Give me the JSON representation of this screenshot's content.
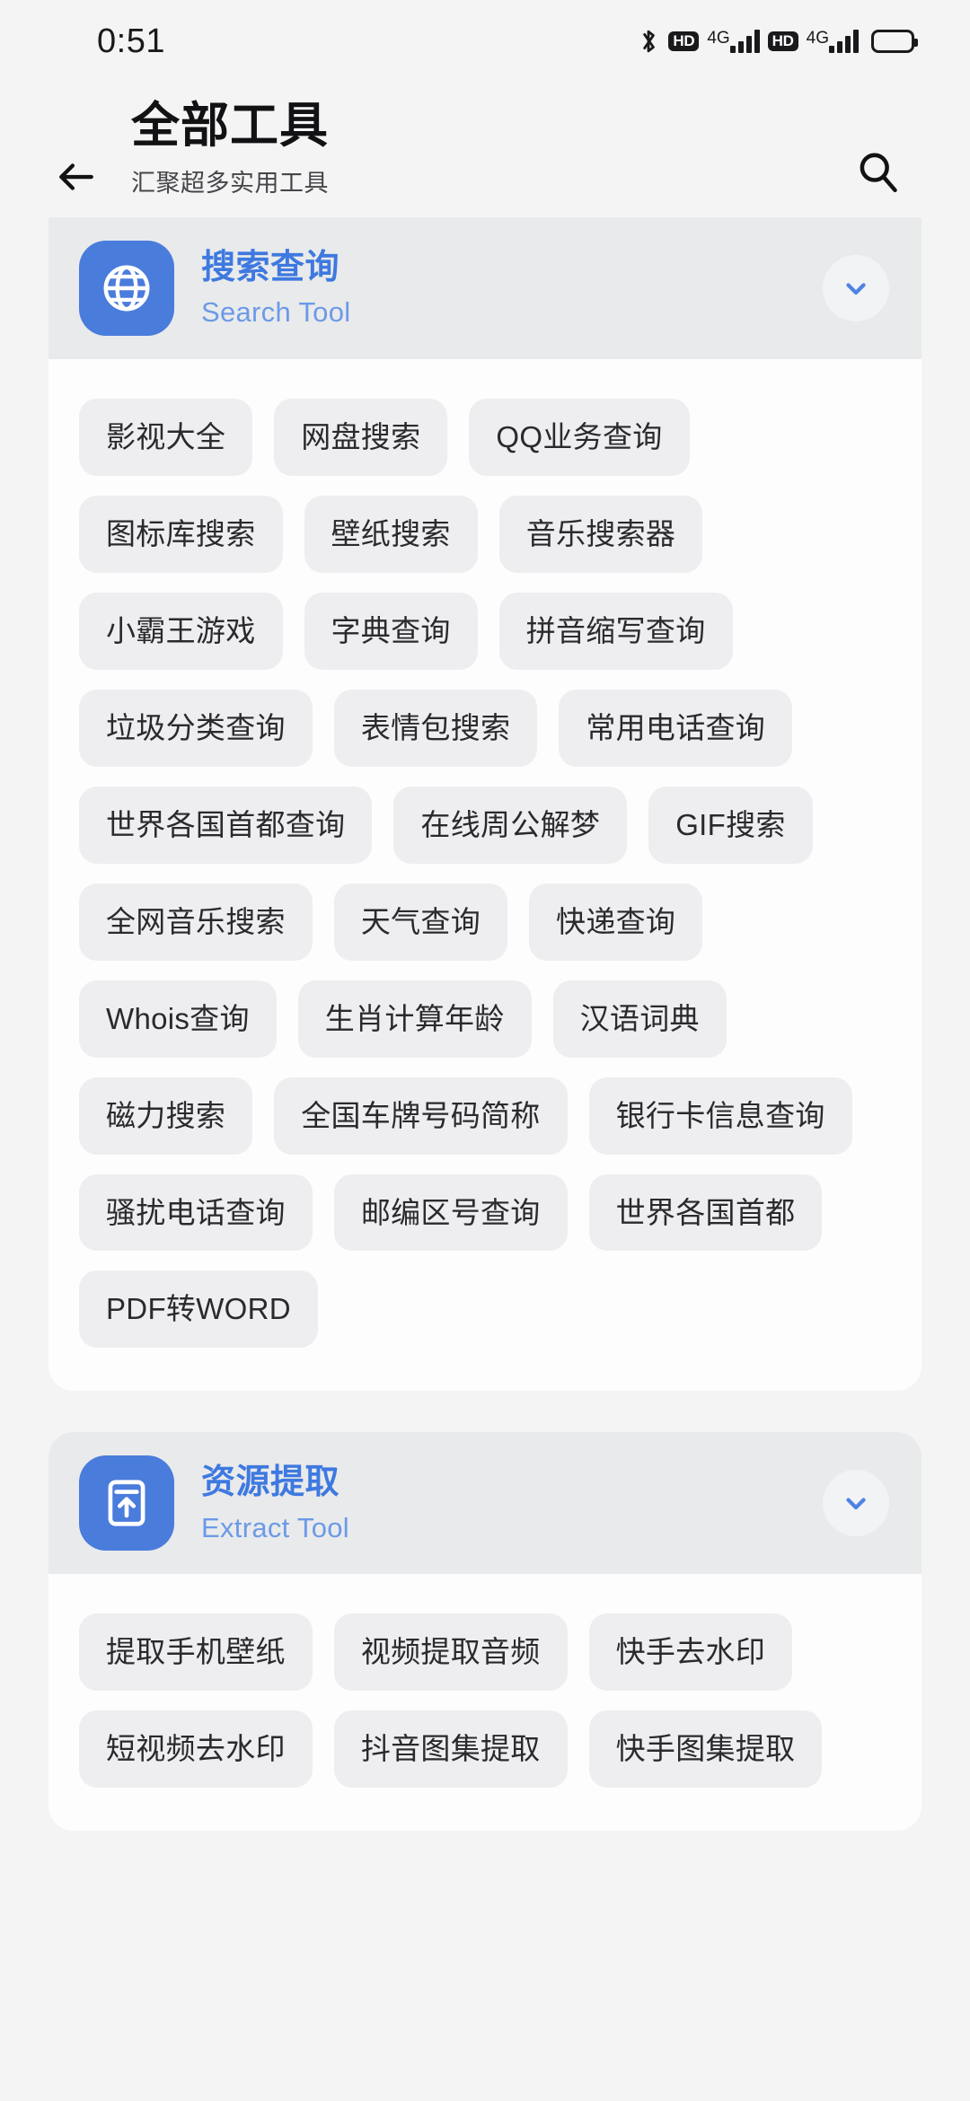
{
  "statusbar": {
    "time": "0:51",
    "icons": [
      "bluetooth-icon",
      "hd-badge",
      "4g-label",
      "signal-bars",
      "hd-badge",
      "4g-label",
      "signal-bars",
      "battery-icon"
    ],
    "hd_label": "HD",
    "network_label": "4G"
  },
  "appbar": {
    "back_icon": "arrow-left-icon",
    "title": "全部工具",
    "subtitle": "汇聚超多实用工具",
    "search_icon": "search-icon"
  },
  "colors": {
    "accent": "#3e79e0",
    "accent_sub": "#6c9ae8",
    "icon_bg": "#4a7cdc",
    "page_bg": "#f4f4f5",
    "card_bg": "#fdfdfd",
    "section_head_bg": "#e9eaeb",
    "chip_bg": "#eeeef0",
    "chip_text": "#2a2a2e"
  },
  "sections": [
    {
      "icon": "globe-icon",
      "title": "搜索查询",
      "subtitle": "Search Tool",
      "chevron": "chevron-down-icon",
      "expanded": true,
      "clipped_top": true,
      "chips": [
        "影视大全",
        "网盘搜索",
        "QQ业务查询",
        "图标库搜索",
        "壁纸搜索",
        "音乐搜索器",
        "小霸王游戏",
        "字典查询",
        "拼音缩写查询",
        "垃圾分类查询",
        "表情包搜索",
        "常用电话查询",
        "世界各国首都查询",
        "在线周公解梦",
        "GIF搜索",
        "全网音乐搜索",
        "天气查询",
        "快递查询",
        "Whois查询",
        "生肖计算年龄",
        "汉语词典",
        "磁力搜索",
        "全国车牌号码简称",
        "银行卡信息查询",
        "骚扰电话查询",
        "邮编区号查询",
        "世界各国首都",
        "PDF转WORD"
      ]
    },
    {
      "icon": "archive-upload-icon",
      "title": "资源提取",
      "subtitle": "Extract Tool",
      "chevron": "chevron-down-icon",
      "expanded": true,
      "clipped_top": false,
      "chips": [
        "提取手机壁纸",
        "视频提取音频",
        "快手去水印",
        "短视频去水印",
        "抖音图集提取",
        "快手图集提取"
      ]
    }
  ]
}
